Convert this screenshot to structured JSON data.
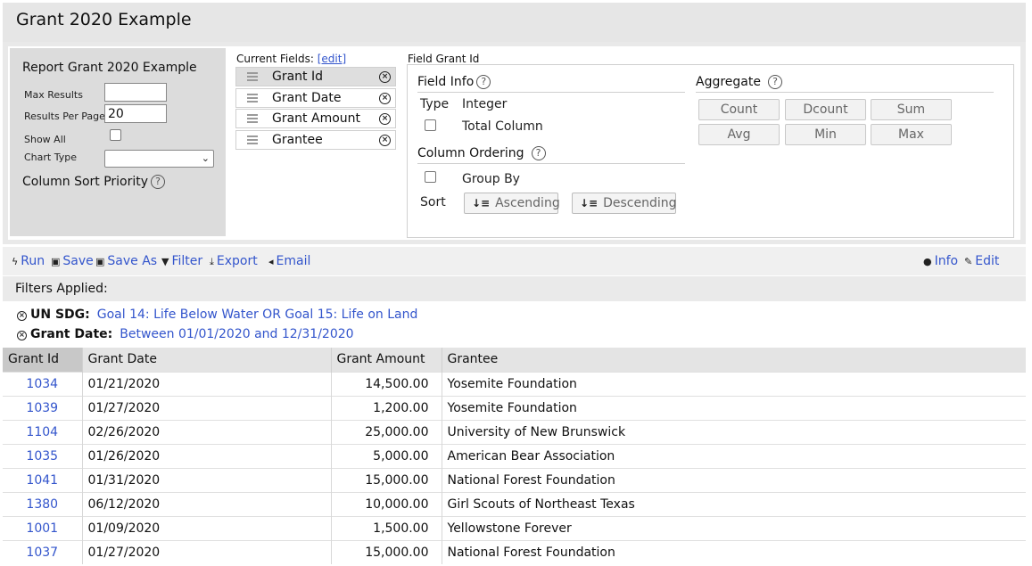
{
  "title": "Grant 2020 Example",
  "report_panel": {
    "title": "Report Grant 2020 Example",
    "max_results_label": "Max Results",
    "max_results_value": "",
    "results_per_page_label": "Results Per Page",
    "results_per_page_value": "20",
    "show_all_label": "Show All",
    "chart_type_label": "Chart Type",
    "chart_type_value": "",
    "column_sort_priority_label": "Column Sort Priority"
  },
  "current_fields": {
    "label": "Current Fields:",
    "edit_link": "[edit]",
    "items": [
      {
        "label": "Grant Id",
        "selected": true
      },
      {
        "label": "Grant Date",
        "selected": false
      },
      {
        "label": "Grant Amount",
        "selected": false
      },
      {
        "label": "Grantee",
        "selected": false
      }
    ]
  },
  "field_panel": {
    "label": "Field Grant Id",
    "field_info_heading": "Field Info",
    "type_label": "Type",
    "type_value": "Integer",
    "total_column_label": "Total Column",
    "column_ordering_heading": "Column Ordering",
    "group_by_label": "Group By",
    "sort_label": "Sort",
    "ascending_label": "Ascending",
    "descending_label": "Descending",
    "aggregate_heading": "Aggregate",
    "aggregate_buttons": [
      "Count",
      "Dcount",
      "Sum",
      "Avg",
      "Min",
      "Max"
    ]
  },
  "toolbar": {
    "run": "Run",
    "save": "Save",
    "save_as": "Save As",
    "filter": "Filter",
    "export": "Export",
    "email": "Email",
    "info": "Info",
    "edit": "Edit"
  },
  "filters": {
    "heading": "Filters Applied:",
    "items": [
      {
        "key": "UN SDG:",
        "value": "Goal 14: Life Below Water OR Goal 15: Life on Land"
      },
      {
        "key": "Grant Date:",
        "value": "Between 01/01/2020 and 12/31/2020"
      }
    ]
  },
  "table": {
    "headers": [
      "Grant Id",
      "Grant Date",
      "Grant Amount",
      "Grantee"
    ],
    "rows": [
      [
        "1034",
        "01/21/2020",
        "14,500.00",
        "Yosemite Foundation"
      ],
      [
        "1039",
        "01/27/2020",
        "1,200.00",
        "Yosemite Foundation"
      ],
      [
        "1104",
        "02/26/2020",
        "25,000.00",
        "University of New Brunswick"
      ],
      [
        "1035",
        "01/26/2020",
        "5,000.00",
        "American Bear Association"
      ],
      [
        "1041",
        "01/31/2020",
        "15,000.00",
        "National Forest Foundation"
      ],
      [
        "1380",
        "06/12/2020",
        "10,000.00",
        "Girl Scouts of Northeast Texas"
      ],
      [
        "1001",
        "01/09/2020",
        "1,500.00",
        "Yellowstone Forever"
      ],
      [
        "1037",
        "01/27/2020",
        "15,000.00",
        "National Forest Foundation"
      ]
    ]
  },
  "colors": {
    "link": "#3355cc",
    "header_bg": "#e4e4e4",
    "panel_bg": "#dcdcdc"
  }
}
